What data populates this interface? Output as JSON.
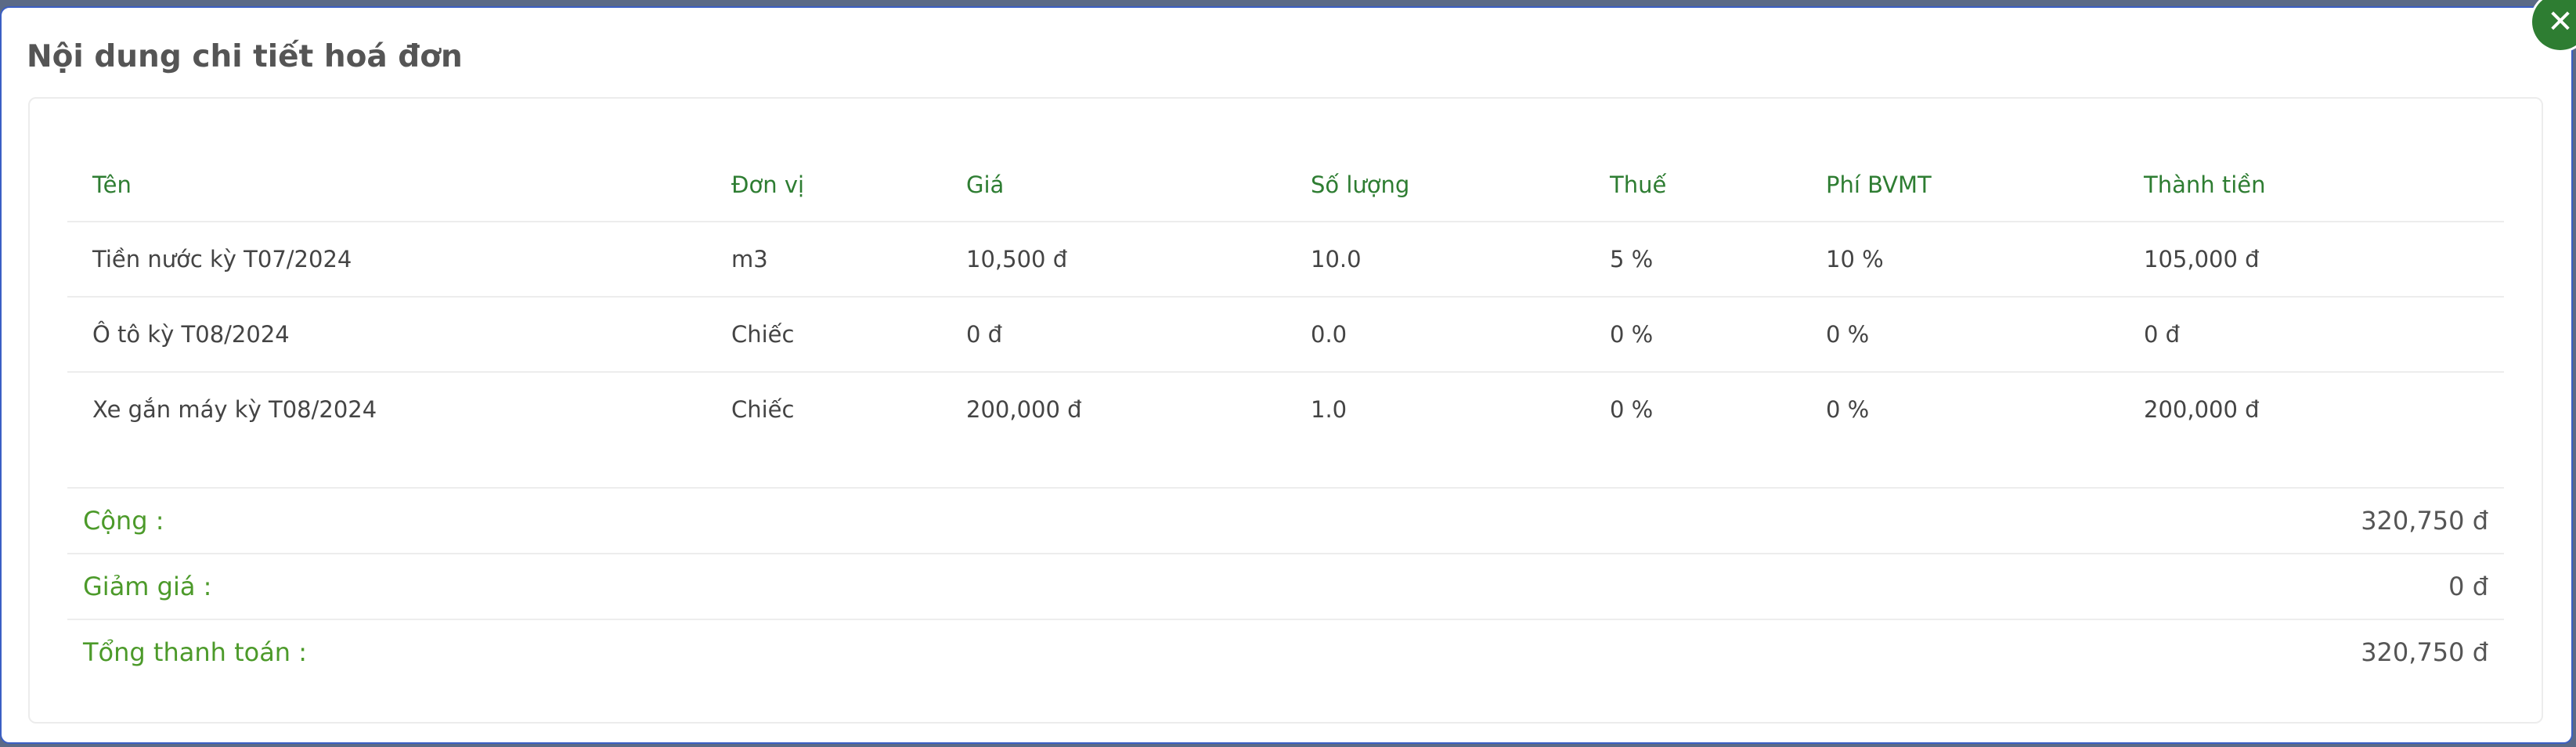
{
  "modal": {
    "title": "Nội dung chi tiết hoá đơn",
    "close_symbol": "✕"
  },
  "table": {
    "headers": [
      "Tên",
      "Đơn vị",
      "Giá",
      "Số lượng",
      "Thuế",
      "Phí BVMT",
      "Thành tiền"
    ],
    "rows": [
      [
        "Tiền nước kỳ T07/2024",
        "m3",
        "10,500 đ",
        "10.0",
        "5 %",
        "10 %",
        "105,000 đ"
      ],
      [
        "Ô tô kỳ T08/2024",
        "Chiếc",
        "0 đ",
        "0.0",
        "0 %",
        "0 %",
        "0 đ"
      ],
      [
        "Xe gắn máy kỳ T08/2024",
        "Chiếc",
        "200,000 đ",
        "1.0",
        "0 %",
        "0 %",
        "200,000 đ"
      ]
    ]
  },
  "summary": {
    "subtotal_label": "Cộng :",
    "subtotal_value": "320,750 đ",
    "discount_label": "Giảm giá :",
    "discount_value": "0 đ",
    "total_label": "Tổng thanh toán :",
    "total_value": "320,750 đ"
  },
  "colors": {
    "accent_green": "#2e7d32",
    "label_green": "#4c9a2a",
    "border_blue": "#3b5fc4"
  },
  "icons": {
    "close": "close-icon"
  }
}
